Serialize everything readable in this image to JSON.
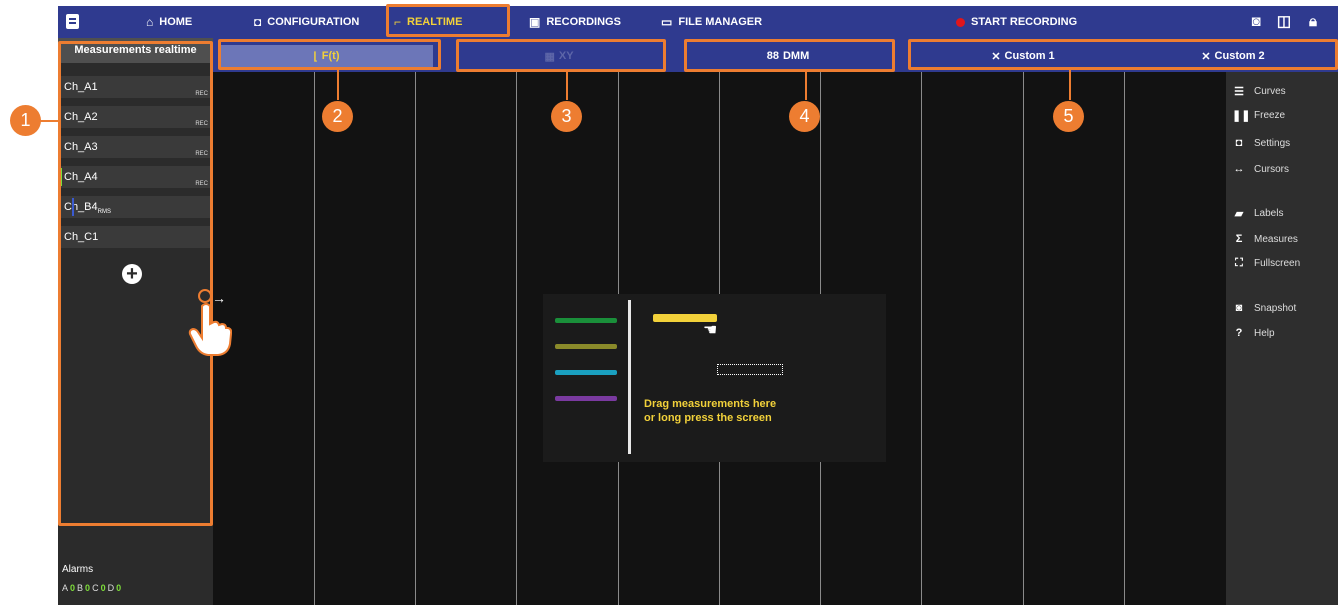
{
  "topbar": {
    "home": "HOME",
    "configuration": "CONFIGURATION",
    "realtime": "REALTIME",
    "recordings": "RECORDINGS",
    "file_manager": "FILE MANAGER",
    "start_recording": "START RECORDING"
  },
  "sidebar": {
    "title": "Measurements realtime",
    "channels": [
      {
        "label": "Ch_A1",
        "rec": "REC"
      },
      {
        "label": "Ch_A2",
        "rec": "REC"
      },
      {
        "label": "Ch_A3",
        "rec": "REC"
      },
      {
        "label": "Ch_A4",
        "rec": "REC"
      },
      {
        "label": "Ch_B4",
        "sub": "RMS"
      },
      {
        "label": "Ch_C1"
      }
    ],
    "alarms_label": "Alarms",
    "alarms": [
      {
        "name": "A",
        "value": "0"
      },
      {
        "name": "B",
        "value": "0"
      },
      {
        "name": "C",
        "value": "0"
      },
      {
        "name": "D",
        "value": "0"
      }
    ]
  },
  "tabs": {
    "ft": "F(t)",
    "xy": "XY",
    "dmm": "DMM",
    "custom1": "Custom 1",
    "custom2": "Custom 2"
  },
  "right_menu": [
    {
      "icon": "curves-icon",
      "glyph": "☰",
      "label": "Curves"
    },
    {
      "icon": "freeze-icon",
      "glyph": "❚❚",
      "label": "Freeze"
    },
    {
      "icon": "settings-icon",
      "glyph": "◘",
      "label": "Settings"
    },
    {
      "icon": "cursors-icon",
      "glyph": "↔",
      "label": "Cursors"
    },
    {
      "icon": "labels-icon",
      "glyph": "▰",
      "label": "Labels"
    },
    {
      "icon": "measures-icon",
      "glyph": "Σ",
      "label": "Measures"
    },
    {
      "icon": "fullscreen-icon",
      "glyph": "⛶",
      "label": "Fullscreen"
    },
    {
      "icon": "snapshot-icon",
      "glyph": "◙",
      "label": "Snapshot"
    },
    {
      "icon": "help-icon",
      "glyph": "?",
      "label": "Help"
    }
  ],
  "hint": {
    "line1": "Drag measurements here",
    "line2": "or long press the screen"
  },
  "callouts": [
    "1",
    "2",
    "3",
    "4",
    "5"
  ],
  "colors": {
    "toolbar": "#2f3a8f",
    "accent_yellow": "#f2d13a",
    "callout_orange": "#ed7d31",
    "record_red": "#e0151b",
    "swatch_green": "#1a8f3a",
    "swatch_olive": "#8a8a2a",
    "swatch_cyan": "#1aa0c0",
    "swatch_purple": "#7a3aa0"
  }
}
